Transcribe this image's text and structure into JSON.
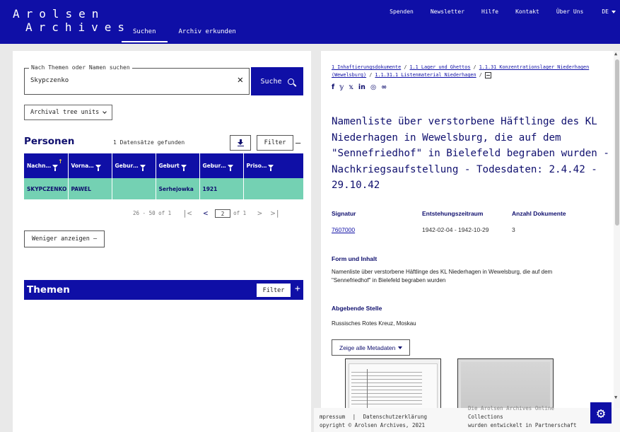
{
  "header": {
    "logo_line1": "Arolsen",
    "logo_line2": "Archives",
    "main_tabs": [
      {
        "label": "Suchen"
      },
      {
        "label": "Archiv erkunden"
      }
    ],
    "top_links": [
      {
        "label": "Spenden"
      },
      {
        "label": "Newsletter"
      },
      {
        "label": "Hilfe"
      },
      {
        "label": "Kontakt"
      },
      {
        "label": "Über Uns"
      }
    ],
    "language": "DE",
    "color": "#0f0fa6"
  },
  "search": {
    "legend": "Nach Themen oder Namen suchen",
    "value": "Skypczenko",
    "clear_symbol": "✕",
    "button_label": "Suche"
  },
  "tree_button": "Archival tree units",
  "persons": {
    "title": "Personen",
    "count": "1 Datensätze gefunden",
    "filter_label": "Filter",
    "collapse_symbol": "–",
    "columns": [
      {
        "label": "Nachn…"
      },
      {
        "label": "Vorna…"
      },
      {
        "label": "Gebur…"
      },
      {
        "label": "Geburt"
      },
      {
        "label": "Gebur…"
      },
      {
        "label": "Priso…"
      }
    ],
    "rows": [
      {
        "cells": [
          "SKYPCZENKO",
          "PAWEL",
          "",
          "Serhejowka",
          "1921",
          ""
        ]
      }
    ],
    "row_color": "#74d1b3"
  },
  "pager": {
    "range": "26 - 50 of 1",
    "first": "|<",
    "prev": "<",
    "page": "2",
    "of": "of 1",
    "next": ">",
    "last": ">|"
  },
  "less_button": "Weniger anzeigen —",
  "themen": {
    "title": "Themen",
    "filter_label": "Filter",
    "expand_symbol": "+"
  },
  "detail": {
    "breadcrumb": [
      {
        "label": "1 Inhaftierungsdokumente"
      },
      {
        "label": "1.1 Lager und Ghettos"
      },
      {
        "label": "1.1.31 Konzentrationslager Niederhagen (Wewelsburg)"
      },
      {
        "label": "1.1.31.1 Listenmaterial Niederhagen"
      }
    ],
    "breadcrumb_sep": "/",
    "social": [
      {
        "label": "f"
      },
      {
        "label": "𝕪"
      },
      {
        "label": "𝕩"
      },
      {
        "label": "in"
      },
      {
        "label": "◎"
      },
      {
        "label": "∞"
      }
    ],
    "title": "Namenliste über verstorbene Häftlinge des KL Niederhagen in Wewelsburg, die auf dem \"Sennefriedhof\" in Bielefeld begraben wurden - Nachkriegsaufstellung - Todesdaten: 2.4.42 - 29.10.42",
    "meta_headers": {
      "signatur": "Signatur",
      "zeitraum": "Entstehungszeitraum",
      "anzahl": "Anzahl Dokumente"
    },
    "meta_values": {
      "signatur": "7607000",
      "zeitraum": "1942-02-04 - 1942-10-29",
      "anzahl": "3"
    },
    "form_header": "Form und Inhalt",
    "form_text": "Namenliste über verstorbene Häftlinge des KL Niederhagen in Wewelsburg, die auf dem \"Sennefriedhof\" in Bielefeld begraben wurden",
    "source_header": "Abgebende Stelle",
    "source_text": "Russisches Rotes Kreuz, Moskau",
    "metadata_button": "Zeige alle Metadaten"
  },
  "footer": {
    "impressum": "mpressum",
    "sep": "|",
    "datenschutz": "Datenschutzerklärung",
    "copyright": "opyright © Arolsen Archives, 2021",
    "cut_line": "Die Arolsen Archives Online",
    "collections": "Collections",
    "developed": "wurden entwickelt in Partnerschaft"
  }
}
